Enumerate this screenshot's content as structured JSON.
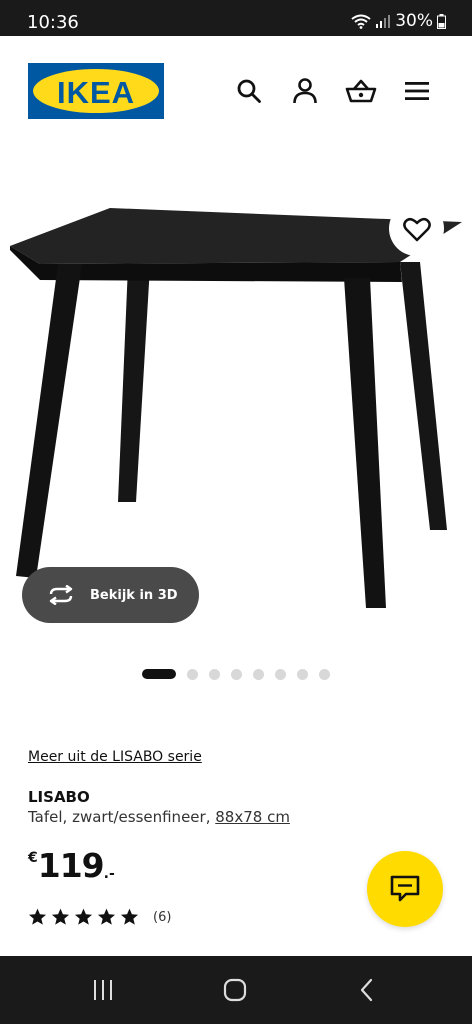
{
  "status_bar": {
    "time": "10:36",
    "battery": "30%",
    "icons": [
      "wifi-icon",
      "signal-icon",
      "battery-icon"
    ]
  },
  "header": {
    "logo_text": "IKEA",
    "icons": [
      "search-icon",
      "account-icon",
      "cart-icon",
      "menu-icon"
    ]
  },
  "product": {
    "image": "black LISABO table",
    "view_3d_label": "Bekijk in 3D",
    "gallery": {
      "count": 8,
      "active_index": 0
    },
    "series_link": "Meer uit de LISABO serie",
    "name": "LISABO",
    "description": "Tafel, zwart/essenfineer,",
    "dimensions": "88x78 cm",
    "price": {
      "currency": "€",
      "amount": "119",
      "decimals": ".-"
    },
    "rating": {
      "stars": 5,
      "max": 5,
      "count": "(6)"
    }
  },
  "colors": {
    "ikea_blue": "#0058a3",
    "ikea_yellow": "#ffda1a",
    "chat_yellow": "#ffdb00",
    "dark": "#111111"
  },
  "nav_bar": {
    "buttons": [
      "recent-apps-icon",
      "home-icon",
      "back-icon"
    ]
  }
}
